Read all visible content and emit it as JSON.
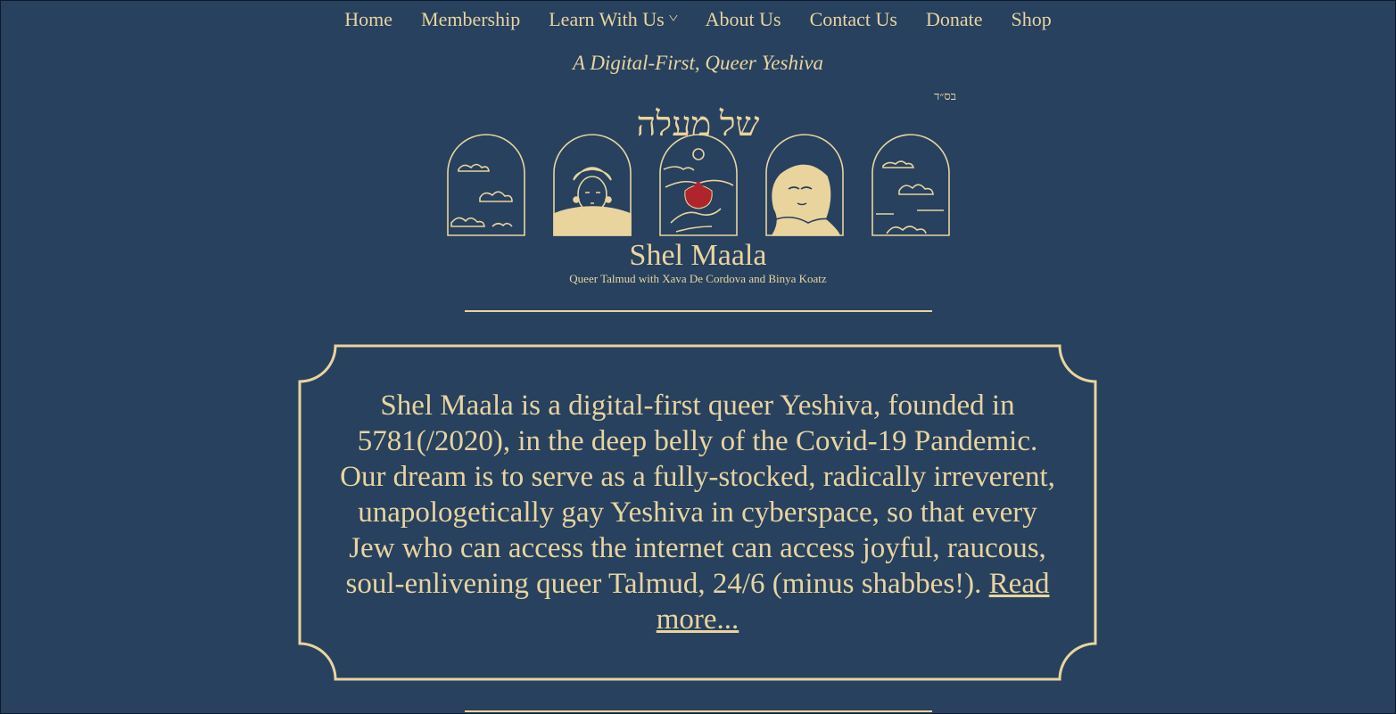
{
  "nav": {
    "items": [
      {
        "label": "Home"
      },
      {
        "label": "Membership"
      },
      {
        "label": "Learn With Us",
        "icon": "chevron-down-icon"
      },
      {
        "label": "About Us"
      },
      {
        "label": "Contact Us"
      },
      {
        "label": "Donate"
      },
      {
        "label": "Shop"
      }
    ]
  },
  "header": {
    "tagline": "A Digital-First, Queer Yeshiva",
    "bsd": "בס״ד"
  },
  "logo": {
    "hebrew": "של מעלה",
    "title": "Shel Maala",
    "subtitle": "Queer Talmud with Xava De Cordova and Binya Koatz",
    "panels": [
      "clouds-left",
      "portrait-turban",
      "pomegranate-hand",
      "portrait-shawl",
      "clouds-right"
    ]
  },
  "intro": {
    "text": "Shel Maala is a digital-first queer Yeshiva, founded in 5781(/2020), in the deep belly of the Covid-19 Pandemic. Our dream is to serve as a fully-stocked, radically irreverent, unapologetically gay Yeshiva in cyberspace, so that every Jew who can access the internet can access joyful, raucous, soul-enlivening queer Talmud, 24/6 (minus shabbes!). ",
    "link": "Read more..."
  },
  "colors": {
    "background": "#27415f",
    "accent": "#e9d49e",
    "pomegranate": "#b0252c"
  }
}
